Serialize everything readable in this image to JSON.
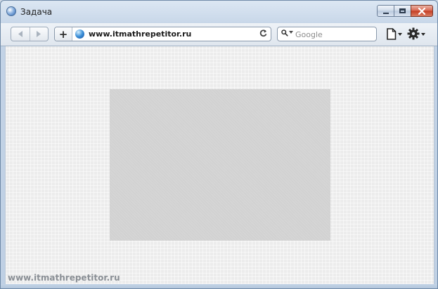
{
  "window": {
    "title": "Задача"
  },
  "toolbar": {
    "back_icon": "back-arrow-icon",
    "forward_icon": "forward-arrow-icon",
    "add_label": "+",
    "address": "www.itmathrepetitor.ru",
    "reload_icon": "reload-icon",
    "search_placeholder": "Google"
  },
  "content": {
    "watermark": "www.itmathrepetitor.ru"
  },
  "colors": {
    "close_button": "#c43c22",
    "content_background": "#ececec",
    "placeholder_box": "#d5d5d5"
  }
}
